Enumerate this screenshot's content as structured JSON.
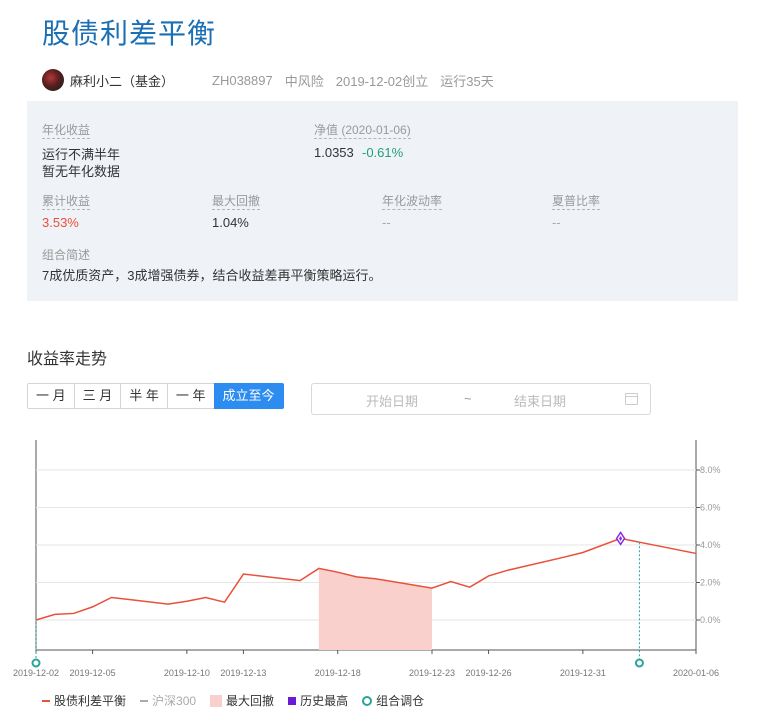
{
  "header": {
    "title": "股债利差平衡",
    "owner": "麻利小二（基金）",
    "code": "ZH038897",
    "risk": "中风险",
    "created": "2019-12-02创立",
    "running": "运行35天"
  },
  "info": {
    "annual_label": "年化收益",
    "annual_line1": "运行不满半年",
    "annual_line2": "暂无年化数据",
    "nav_label": "净值 (2020-01-06)",
    "nav_value": "1.0353",
    "nav_change": "-0.61%",
    "cum_label": "累计收益",
    "cum_value": "3.53%",
    "drawdown_label": "最大回撤",
    "drawdown_value": "1.04%",
    "vol_label": "年化波动率",
    "vol_value": "--",
    "sharpe_label": "夏普比率",
    "sharpe_value": "--",
    "desc_label": "组合简述",
    "desc_text": "7成优质资产，3成增强债券，结合收益差再平衡策略运行。"
  },
  "section": {
    "title": "收益率走势"
  },
  "tabs": [
    "一 月",
    "三 月",
    "半 年",
    "一 年",
    "成立至今"
  ],
  "active_tab": 4,
  "daterange": {
    "start": "开始日期",
    "tilde": "~",
    "end": "结束日期"
  },
  "legend": {
    "portfolio": "股债利差平衡",
    "index": "沪深300",
    "drawdown": "最大回撤",
    "high": "历史最高",
    "rebalance": "组合调仓"
  },
  "colors": {
    "title": "#1a6fb5",
    "line": "#e8503a",
    "drawdown_fill": "#f9d0cc",
    "high": "#8a2be2",
    "rebalance": "#26a69a",
    "active_tab": "#2d8cf0",
    "up": "#e8503a",
    "down": "#23a179"
  },
  "chart_data": {
    "type": "line",
    "y_ticks": [
      "8.0%",
      "6.0%",
      "4.0%",
      "2.0%",
      "0.0%"
    ],
    "x_ticks": [
      "2019-12-02",
      "2019-12-05",
      "2019-12-10",
      "2019-12-13",
      "2019-12-18",
      "2019-12-23",
      "2019-12-26",
      "2019-12-31",
      "2020-01-06"
    ],
    "ylim": [
      -1.6,
      9.6
    ],
    "x": [
      "2019-12-02",
      "2019-12-03",
      "2019-12-04",
      "2019-12-05",
      "2019-12-06",
      "2019-12-09",
      "2019-12-10",
      "2019-12-11",
      "2019-12-12",
      "2019-12-13",
      "2019-12-16",
      "2019-12-17",
      "2019-12-18",
      "2019-12-19",
      "2019-12-20",
      "2019-12-23",
      "2019-12-24",
      "2019-12-25",
      "2019-12-26",
      "2019-12-27",
      "2019-12-30",
      "2019-12-31",
      "2020-01-02",
      "2020-01-03",
      "2020-01-06"
    ],
    "series": [
      {
        "name": "股债利差平衡",
        "values": [
          0.0,
          0.3,
          0.35,
          0.7,
          1.2,
          0.85,
          1.0,
          1.2,
          0.95,
          2.45,
          2.1,
          2.75,
          2.55,
          2.3,
          2.2,
          1.7,
          2.05,
          1.75,
          2.35,
          2.65,
          3.35,
          3.6,
          4.35,
          4.15,
          3.55
        ]
      }
    ],
    "drawdown_range": [
      "2019-12-17",
      "2019-12-23"
    ],
    "historical_high": {
      "x": "2020-01-02",
      "y": 4.35
    },
    "rebalance_points": [
      "2019-12-02",
      "2020-01-03"
    ]
  }
}
